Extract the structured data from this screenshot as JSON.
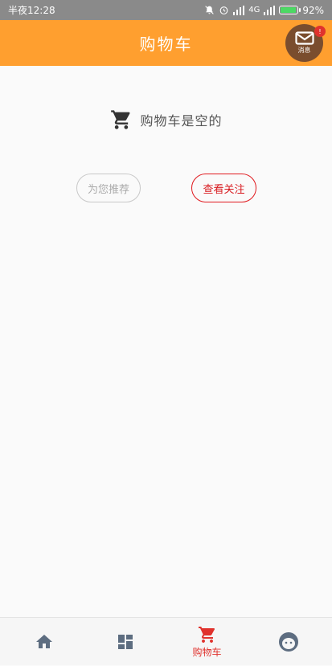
{
  "status_bar": {
    "time": "半夜12:28",
    "network": "4G",
    "battery": "92%",
    "battery_level": 0.92
  },
  "header": {
    "title": "购物车",
    "message_label": "消息",
    "message_badge": "!"
  },
  "empty_state": {
    "text": "购物车是空的"
  },
  "buttons": {
    "recommend": "为您推荐",
    "following": "查看关注"
  },
  "tabbar": {
    "items": [
      {
        "icon": "home-icon",
        "label": ""
      },
      {
        "icon": "category-grid-icon",
        "label": ""
      },
      {
        "icon": "cart-icon",
        "label": "购物车",
        "active": true
      },
      {
        "icon": "profile-face-icon",
        "label": ""
      }
    ]
  },
  "colors": {
    "accent": "#ff9f2f",
    "active": "#e0322d",
    "icon_inactive": "#5d6d80",
    "message_button": "#7a4d2e"
  }
}
